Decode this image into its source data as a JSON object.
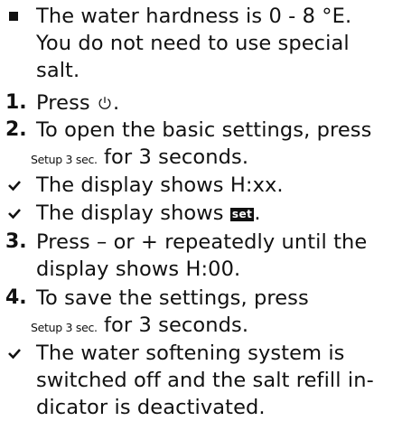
{
  "intro": {
    "line1": "The water hardness is 0 - 8 °E.",
    "line2": "You do not need to use special",
    "line3": "salt."
  },
  "steps": {
    "s1": {
      "num": "1.",
      "text": "Press",
      "icon": "power-icon",
      "tail": "."
    },
    "s2": {
      "num": "2.",
      "line1": "To open the basic settings, press",
      "key": "Setup 3 sec.",
      "line2_tail": "for 3 seconds."
    },
    "r1": {
      "text": "The display shows H:xx."
    },
    "r2": {
      "text": "The display shows",
      "lcd": "set",
      "tail": "."
    },
    "s3": {
      "num": "3.",
      "line1": "Press – or + repeatedly until the",
      "line2": "display shows H:00."
    },
    "s4": {
      "num": "4.",
      "line1": "To save the settings, press",
      "key": "Setup 3 sec.",
      "line2_tail": "for 3 seconds."
    },
    "r3": {
      "line1": "The water softening system is",
      "line2": "switched off and the salt refill in-",
      "line3": "dicator is deactivated."
    }
  }
}
